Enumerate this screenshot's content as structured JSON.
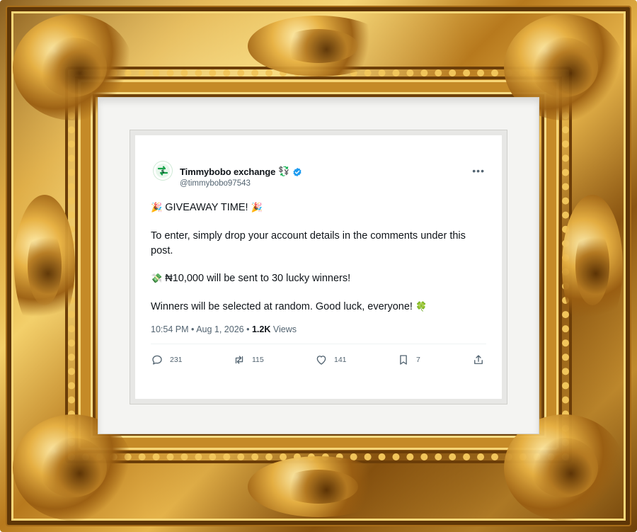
{
  "tweet": {
    "author": {
      "display_name": "Timmybobo exchange",
      "name_emoji": "💱",
      "verified": true,
      "handle": "@timmybobo97543"
    },
    "more_label": "•••",
    "lines": {
      "line1_emoji_left": "🎉",
      "line1_text": "GIVEAWAY TIME!",
      "line1_emoji_right": "🎉",
      "line2_text": "To enter, simply drop your account details in the comments under this post.",
      "line3_emoji": "💸",
      "line3_text": "₦10,000 will be sent to 30 lucky winners!",
      "line4_text": "Winners will be selected at random. Good luck, everyone!",
      "line4_emoji": "🍀"
    },
    "meta": {
      "time": "10:54 PM",
      "separator": "•",
      "date": "Aug 1, 2026",
      "views_count": "1.2K",
      "views_label": "Views"
    },
    "actions": {
      "replies": "231",
      "reposts": "115",
      "likes": "141",
      "bookmarks": "7"
    },
    "colors": {
      "verified_badge": "#1d9bf0",
      "text_primary": "#0f1419",
      "text_secondary": "#536471",
      "avatar_brand": "#16a34a"
    }
  },
  "frame": {
    "style": "ornate gold picture frame",
    "mat_color": "#f4f4f2"
  }
}
